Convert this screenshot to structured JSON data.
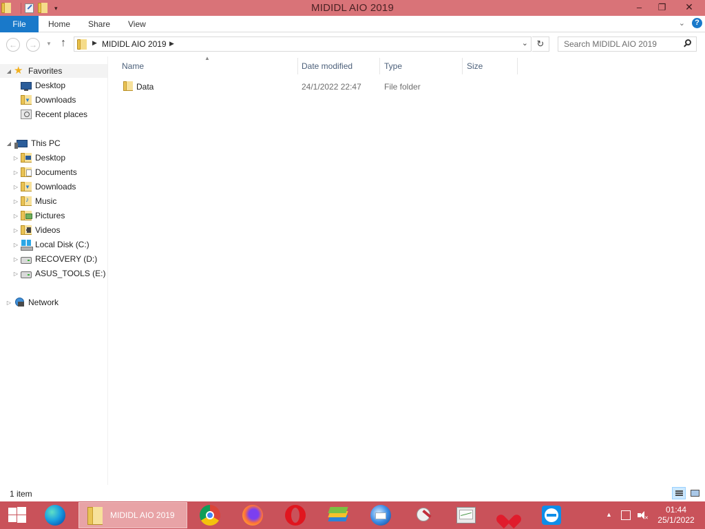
{
  "window": {
    "title": "MIDIDL AIO 2019",
    "controls": {
      "minimize": "–",
      "restore": "❐",
      "close": "✕"
    }
  },
  "ribbon": {
    "file_tab": "File",
    "tabs": [
      "Home",
      "Share",
      "View"
    ],
    "collapse_glyph": "⌄",
    "help_glyph": "?"
  },
  "navigation": {
    "back_glyph": "←",
    "forward_glyph": "→",
    "up_glyph": "↑",
    "breadcrumb": [
      "MIDIDL AIO 2019"
    ],
    "address_dropdown_glyph": "⌄",
    "refresh_glyph": "↻",
    "search_placeholder": "Search MIDIDL AIO 2019"
  },
  "nav_pane": {
    "favorites": {
      "label": "Favorites",
      "items": [
        "Desktop",
        "Downloads",
        "Recent places"
      ]
    },
    "this_pc": {
      "label": "This PC",
      "items": [
        "Desktop",
        "Documents",
        "Downloads",
        "Music",
        "Pictures",
        "Videos",
        "Local Disk (C:)",
        "RECOVERY (D:)",
        "ASUS_TOOLS (E:)"
      ]
    },
    "network": {
      "label": "Network"
    }
  },
  "file_list": {
    "columns": [
      "Name",
      "Date modified",
      "Type",
      "Size"
    ],
    "rows": [
      {
        "name": "Data",
        "date_modified": "24/1/2022 22:47",
        "type": "File folder",
        "size": ""
      }
    ]
  },
  "status_bar": {
    "item_count": "1 item"
  },
  "taskbar": {
    "active_window_label": "MIDIDL AIO 2019",
    "pinned_apps": [
      "edge-icon",
      "file-explorer-icon",
      "chrome-icon",
      "firefox-icon",
      "opera-icon",
      "bluestacks-icon",
      "thunderbird-icon",
      "paint-tool-icon",
      "system-monitor-icon",
      "heart-app-icon",
      "teamviewer-icon"
    ],
    "tray": {
      "show_hidden_glyph": "▲"
    },
    "clock": {
      "time": "01:44",
      "date": "25/1/2022"
    }
  },
  "colors": {
    "title_bar": "#d97378",
    "file_tab": "#1979ca",
    "taskbar": "#c9525a"
  }
}
